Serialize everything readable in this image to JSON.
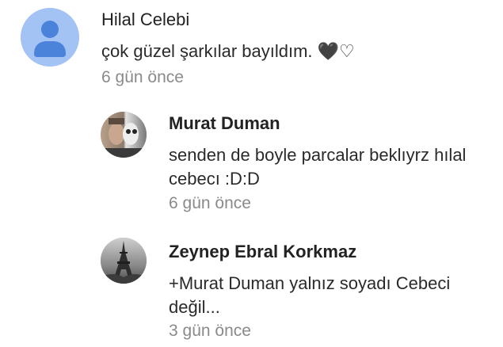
{
  "comment": {
    "author": "Hilal Celebi",
    "text": "çok güzel şarkılar bayıldım. 🖤♡",
    "time": "6 gün önce"
  },
  "replies": [
    {
      "author": "Murat Duman",
      "text": "senden de boyle parcalar beklıyrz hılal cebecı :D:D",
      "time": "6 gün önce"
    },
    {
      "author": "Zeynep Ebral Korkmaz",
      "text": "+Murat Duman yalnız soyadı Cebeci değil...",
      "time": "3 gün önce"
    }
  ],
  "colors": {
    "default_avatar_bg": "#a4c3f5",
    "default_avatar_fg": "#4a83d9",
    "timestamp": "#8a8a8a"
  },
  "icons": {
    "top_avatar": "default-user-avatar-icon",
    "reply1_avatar": "profile-photo-avatar",
    "reply2_avatar": "eiffel-tower-photo-avatar"
  }
}
